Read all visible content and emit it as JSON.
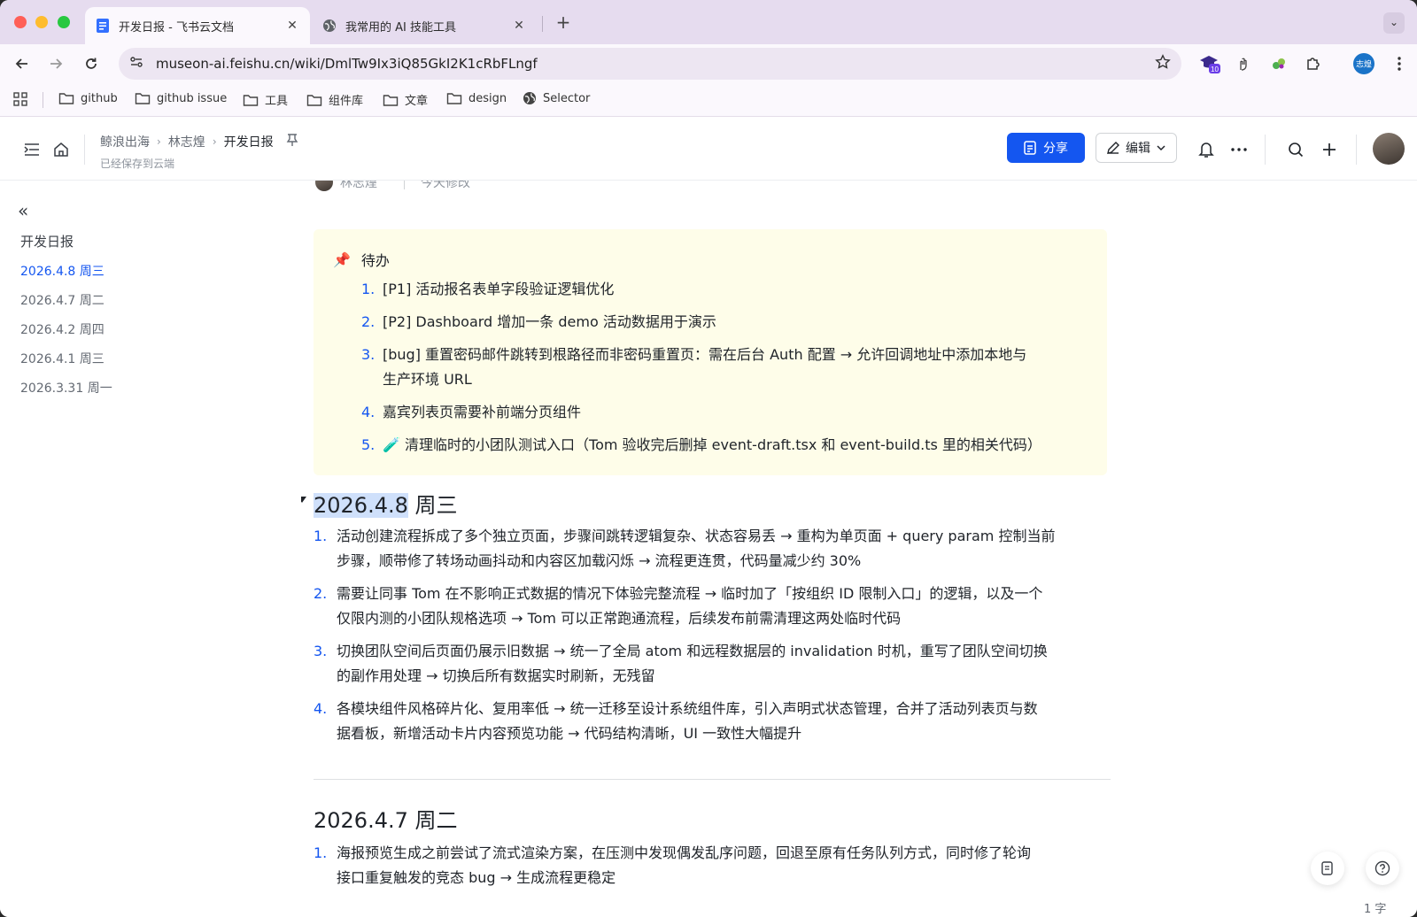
{
  "browser": {
    "tabs": [
      {
        "title": "开发日报 - 飞书云文档",
        "active": true
      },
      {
        "title": "我常用的 AI 技能工具",
        "active": false
      }
    ],
    "new_tab": "+",
    "url": "museon-ai.feishu.cn/wiki/DmlTw9Ix3iQ85GkI2K1cRbFLngf",
    "extension_badge": "10",
    "profile_label": "志煌",
    "bookmarks": [
      "github",
      "github issue",
      "工具",
      "组件库",
      "文章",
      "design",
      "Selector"
    ]
  },
  "header": {
    "breadcrumb": [
      "鲸浪出海",
      "林志煌",
      "开发日报"
    ],
    "saved_status": "已经保存到云端",
    "share_label": "分享",
    "edit_label": "编辑"
  },
  "sidebar": {
    "title": "开发日报",
    "items": [
      {
        "label": "2026.4.8 周三",
        "active": true
      },
      {
        "label": "2026.4.7 周二",
        "active": false
      },
      {
        "label": "2026.4.2 周四",
        "active": false
      },
      {
        "label": "2026.4.1 周三",
        "active": false
      },
      {
        "label": "2026.3.31 周一",
        "active": false
      }
    ]
  },
  "doc": {
    "author": "林志煌",
    "modified": "今天修改",
    "todo": {
      "icon": "📌",
      "title": "待办",
      "items": [
        {
          "num": "1.",
          "text": "[P1] 活动报名表单字段验证逻辑优化"
        },
        {
          "num": "2.",
          "text": "[P2] Dashboard 增加一条 demo 活动数据用于演示"
        },
        {
          "num": "3.",
          "line1": "[bug] 重置密码邮件跳转到根路径而非密码重置页：需在后台 Auth 配置 → 允许回调地址中添加本地与",
          "line2": "生产环境 URL"
        },
        {
          "num": "4.",
          "text": "嘉宾列表页需要补前端分页组件"
        },
        {
          "num": "5.",
          "text": "🧪 清理临时的小团队测试入口（Tom 验收完后删掉 event-draft.tsx 和 event-build.ts 里的相关代码）"
        }
      ]
    },
    "section1": {
      "heading_date": "2026.4.8",
      "heading_day": " 周三",
      "items": [
        {
          "num": "1.",
          "line1": "活动创建流程拆成了多个独立页面，步骤间跳转逻辑复杂、状态容易丢 → 重构为单页面 + query param 控制当前",
          "line2": "步骤，顺带修了转场动画抖动和内容区加载闪烁 → 流程更连贯，代码量减少约 30%"
        },
        {
          "num": "2.",
          "line1": "需要让同事 Tom 在不影响正式数据的情况下体验完整流程 → 临时加了「按组织 ID 限制入口」的逻辑，以及一个",
          "line2": "仅限内测的小团队规格选项 → Tom 可以正常跑通流程，后续发布前需清理这两处临时代码"
        },
        {
          "num": "3.",
          "line1": "切换团队空间后页面仍展示旧数据 → 统一了全局 atom 和远程数据层的 invalidation 时机，重写了团队空间切换",
          "line2": "的副作用处理 → 切换后所有数据实时刷新，无残留"
        },
        {
          "num": "4.",
          "line1": "各模块组件风格碎片化、复用率低 → 统一迁移至设计系统组件库，引入声明式状态管理，合并了活动列表页与数",
          "line2": "据看板，新增活动卡片内容预览功能 → 代码结构清晰，UI 一致性大幅提升"
        }
      ]
    },
    "section2": {
      "heading": "2026.4.7 周二",
      "items": [
        {
          "num": "1.",
          "line1": "海报预览生成之前尝试了流式渲染方案，在压测中发现偶发乱序问题，回退至原有任务队列方式，同时修了轮询",
          "line2": "接口重复触发的竞态 bug → 生成流程更稳定"
        }
      ]
    },
    "word_count": "1 字"
  }
}
